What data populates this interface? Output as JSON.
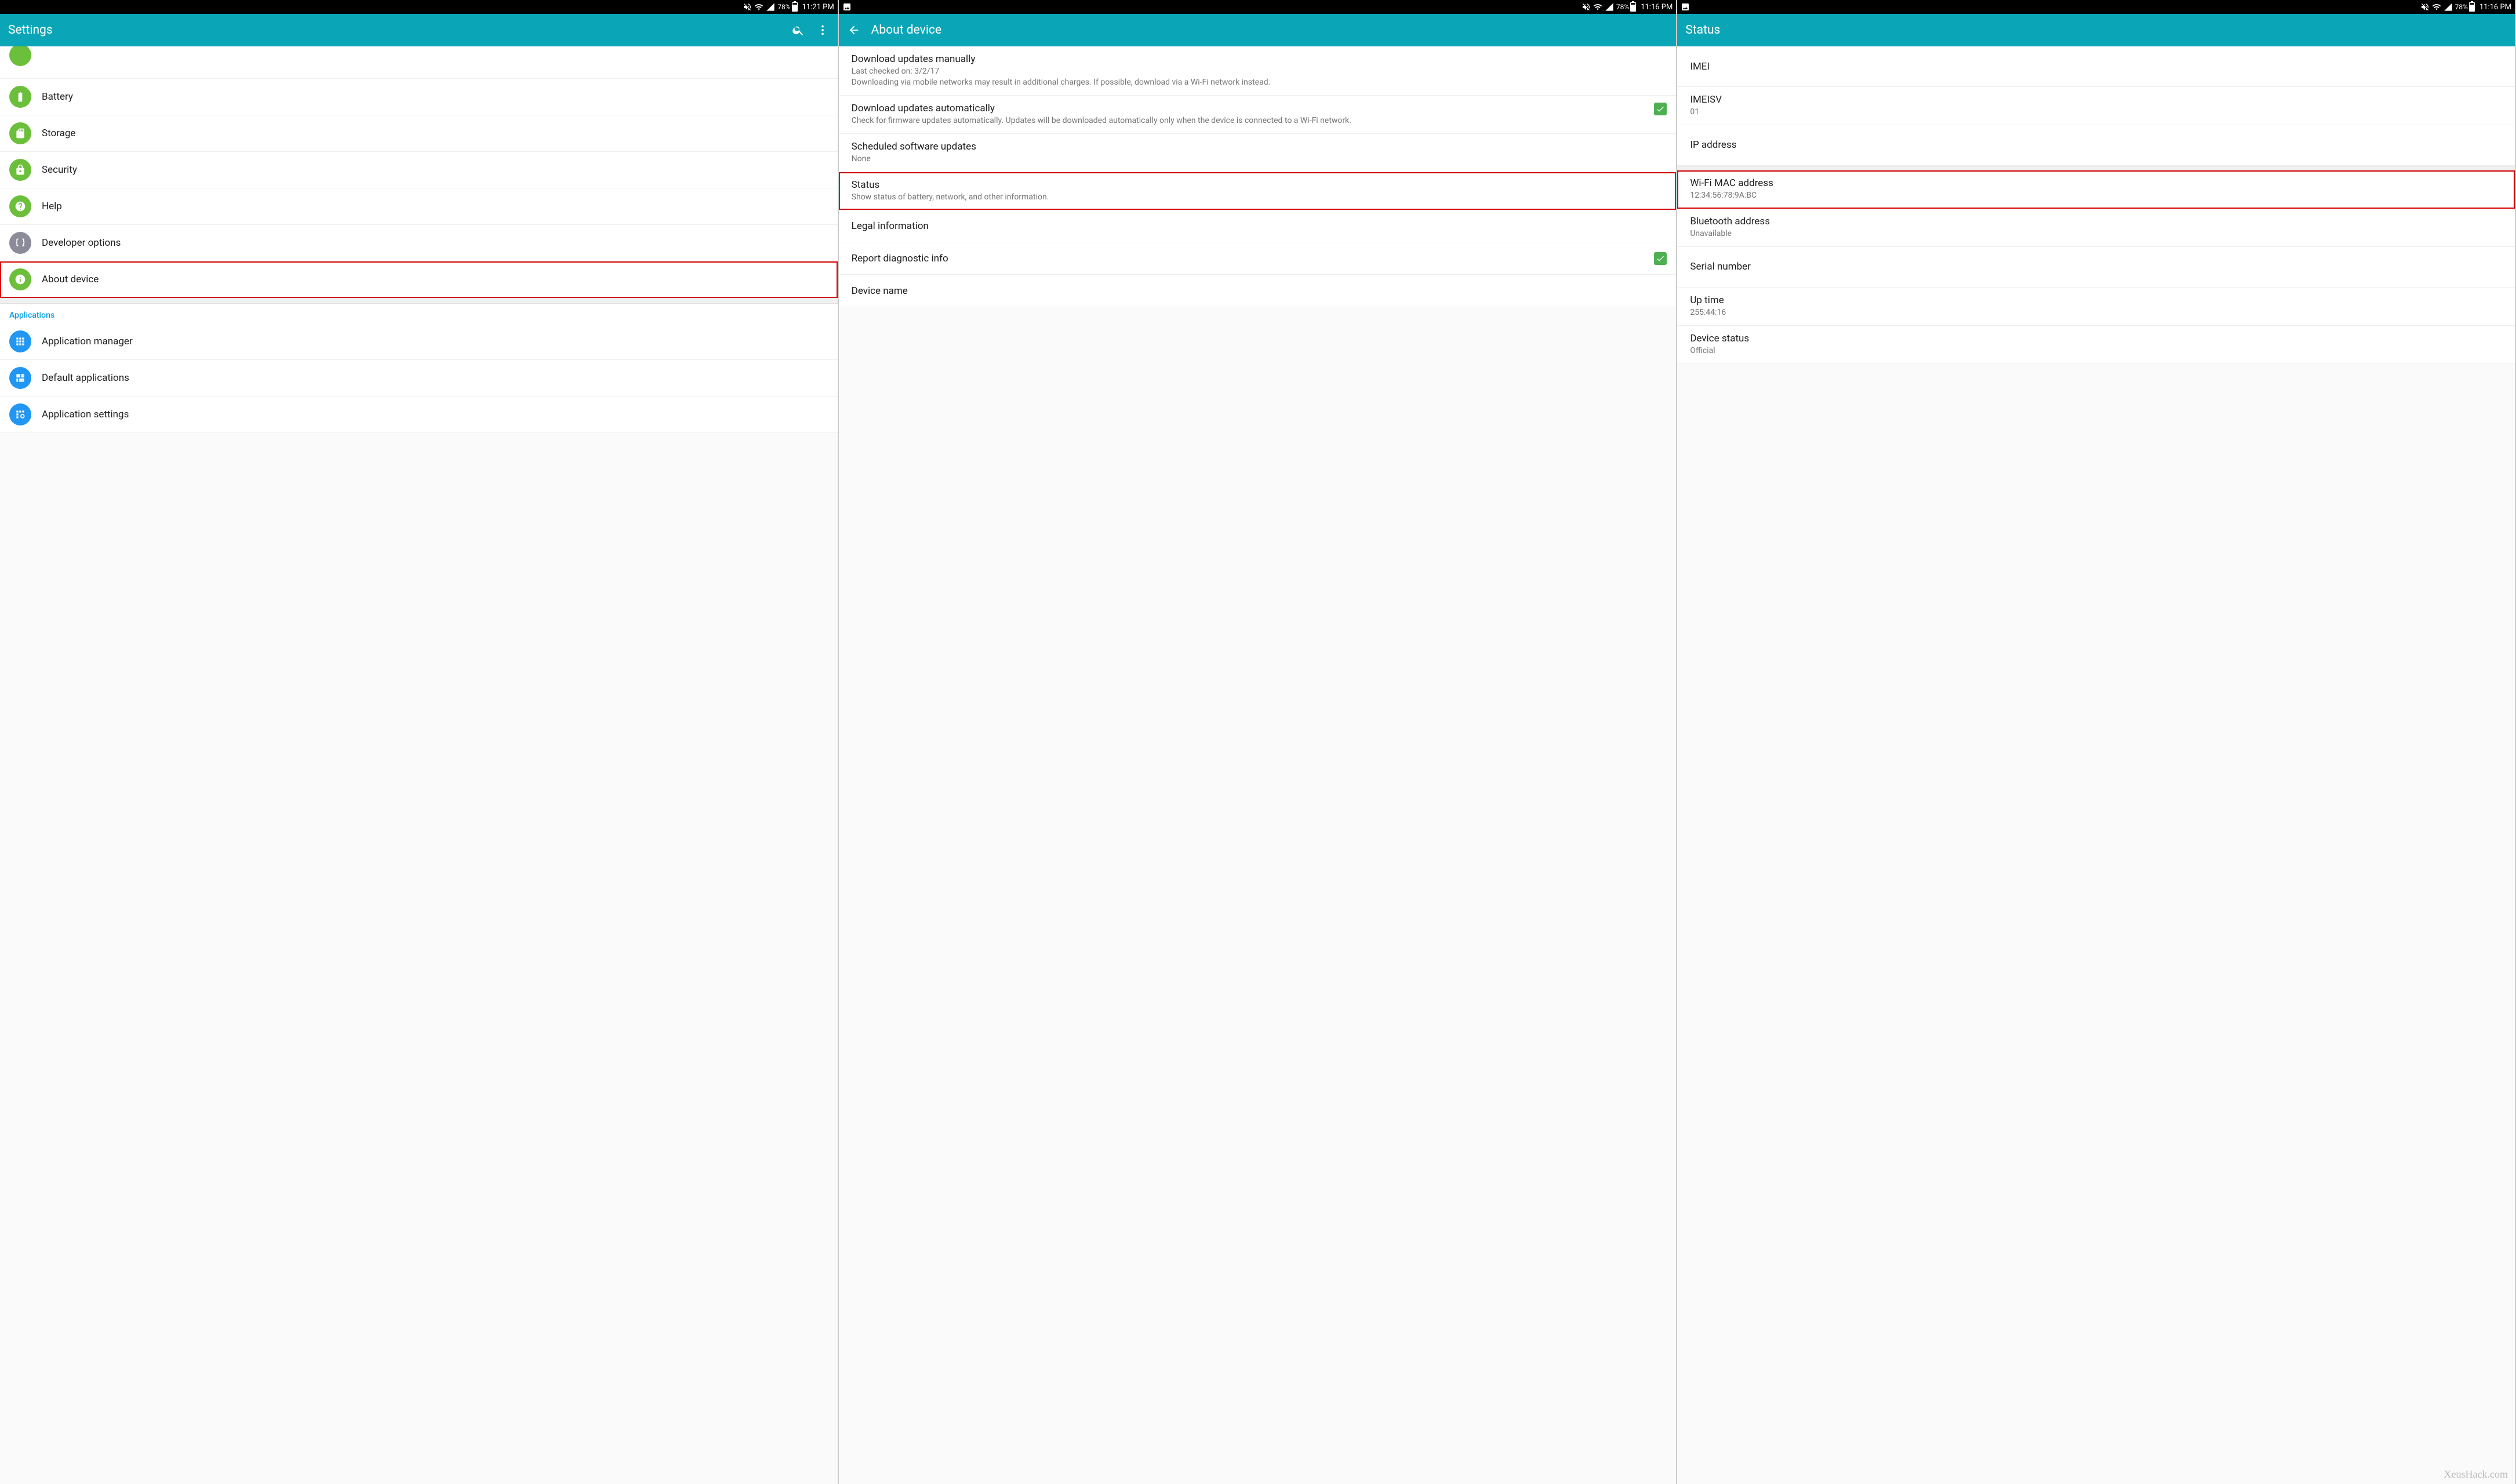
{
  "statusbar": {
    "battery_pct": "78%",
    "battery_fill_pct": 78
  },
  "screens": [
    {
      "time": "11:21 PM",
      "has_left_icon": false,
      "appbar": {
        "title": "Settings",
        "back": false,
        "search": true,
        "menu": true
      }
    },
    {
      "time": "11:16 PM",
      "has_left_icon": true,
      "appbar": {
        "title": "About device",
        "back": true,
        "search": false,
        "menu": false
      }
    },
    {
      "time": "11:16 PM",
      "has_left_icon": true,
      "appbar": {
        "title": "Status",
        "back": false,
        "search": false,
        "menu": false
      }
    }
  ],
  "screen1": {
    "items": {
      "battery": "Battery",
      "storage": "Storage",
      "security": "Security",
      "help": "Help",
      "developer": "Developer options",
      "about": "About device"
    },
    "section_applications": "Applications",
    "apps": {
      "manager": "Application manager",
      "defaults": "Default applications",
      "settings": "Application settings"
    }
  },
  "screen2": {
    "download_manual": {
      "title": "Download updates manually",
      "sub": "Last checked on: 3/2/17\nDownloading via mobile networks may result in additional charges. If possible, download via a Wi-Fi network instead."
    },
    "download_auto": {
      "title": "Download updates automatically",
      "sub": "Check for firmware updates automatically. Updates will be downloaded automatically only when the device is connected to a Wi-Fi network."
    },
    "scheduled": {
      "title": "Scheduled software updates",
      "sub": "None"
    },
    "status": {
      "title": "Status",
      "sub": "Show status of battery, network, and other information."
    },
    "legal": {
      "title": "Legal information"
    },
    "report": {
      "title": "Report diagnostic info"
    },
    "device_name": {
      "title": "Device name"
    }
  },
  "screen3": {
    "imei": {
      "title": "IMEI"
    },
    "imeisv": {
      "title": "IMEISV",
      "sub": "01"
    },
    "ip": {
      "title": "IP address"
    },
    "wifi_mac": {
      "title": "Wi-Fi MAC address",
      "sub": "12:34:56:78:9A:BC"
    },
    "bt": {
      "title": "Bluetooth address",
      "sub": "Unavailable"
    },
    "serial": {
      "title": "Serial number"
    },
    "uptime": {
      "title": "Up time",
      "sub": "255:44:16"
    },
    "devstatus": {
      "title": "Device status",
      "sub": "Official"
    }
  },
  "watermark": "XeusHack.com"
}
